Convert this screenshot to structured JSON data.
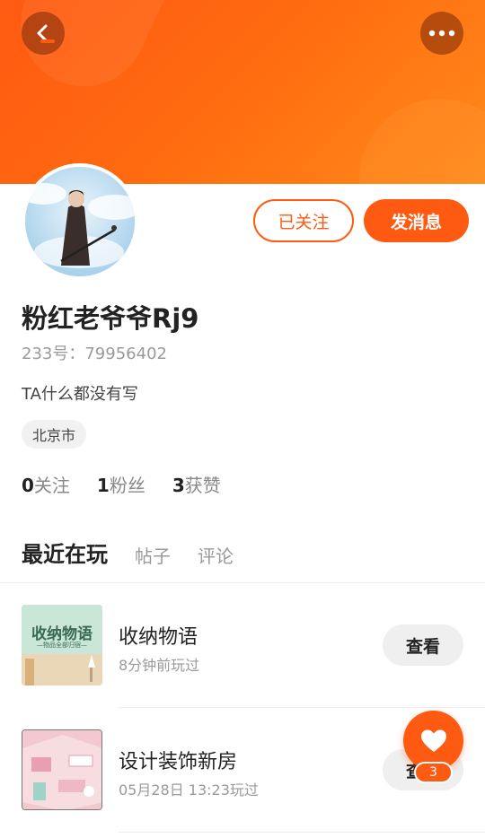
{
  "profile": {
    "username": "粉红老爷爷Rj9",
    "account_id": "233号：79956402",
    "bio": "TA什么都没有写",
    "location": "北京市"
  },
  "actions": {
    "follow_label": "已关注",
    "message_label": "发消息"
  },
  "stats": [
    {
      "count": "0",
      "label": "关注"
    },
    {
      "count": "1",
      "label": "粉丝"
    },
    {
      "count": "3",
      "label": "获赞"
    }
  ],
  "tabs": [
    {
      "label": "最近在玩",
      "active": true
    },
    {
      "label": "帖子",
      "active": false
    },
    {
      "label": "评论",
      "active": false
    }
  ],
  "games": [
    {
      "title": "收纳物语",
      "subtitle": "8分钟前玩过",
      "button": "查看",
      "thumb_text": "收纳物语",
      "thumb_subtext": "—物品全部归宿—"
    },
    {
      "title": "设计装饰新房",
      "subtitle": "05月28日 13:23玩过",
      "button": "查看"
    }
  ],
  "like": {
    "count": "3"
  },
  "icons": {
    "back": "back-arrow-icon",
    "more": "more-dots-icon",
    "heart": "heart-icon"
  },
  "colors": {
    "accent": "#ff5a12",
    "header_start": "#ff5a12",
    "header_end": "#ff8a1a"
  }
}
